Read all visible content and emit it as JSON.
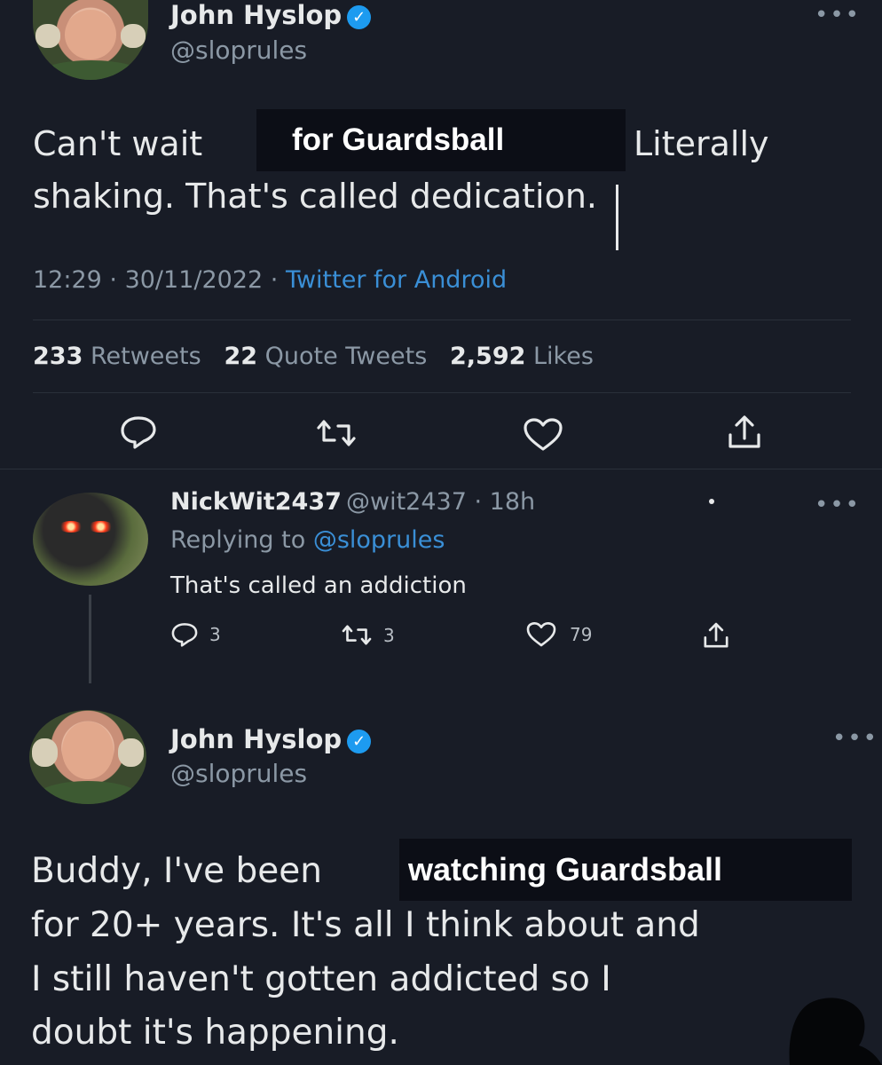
{
  "tweet": {
    "author": {
      "name": "John Hyslop",
      "handle": "@sloprules"
    },
    "text_before": "Can't wait",
    "redacted_1": "for Guardsball",
    "text_after_1": "Literally",
    "line2": "shaking. That's called dedication.",
    "time": "12:29",
    "date": "30/11/2022",
    "source": "Twitter for Android",
    "retweets_count": "233",
    "retweets_label": "Retweets",
    "quotes_count": "22",
    "quotes_label": "Quote Tweets",
    "likes_count": "2,592",
    "likes_label": "Likes",
    "more": "•••"
  },
  "reply": {
    "author": {
      "name": "NickWit2437",
      "handle": "@wit2437",
      "age": "18h"
    },
    "replying_prefix": "Replying to",
    "replying_to": "@sloprules",
    "text": "That's called an addiction",
    "reply_count": "3",
    "retweet_count": "3",
    "like_count": "79",
    "more": "•••"
  },
  "response": {
    "author": {
      "name": "John Hyslop",
      "handle": "@sloprules"
    },
    "text_before": "Buddy, I've been",
    "redacted": "watching Guardsball",
    "line2": "for 20+ years. It's all I think about and",
    "line3": "I still haven't gotten addicted so I",
    "line4": "doubt it's happening.",
    "more": "•••"
  }
}
